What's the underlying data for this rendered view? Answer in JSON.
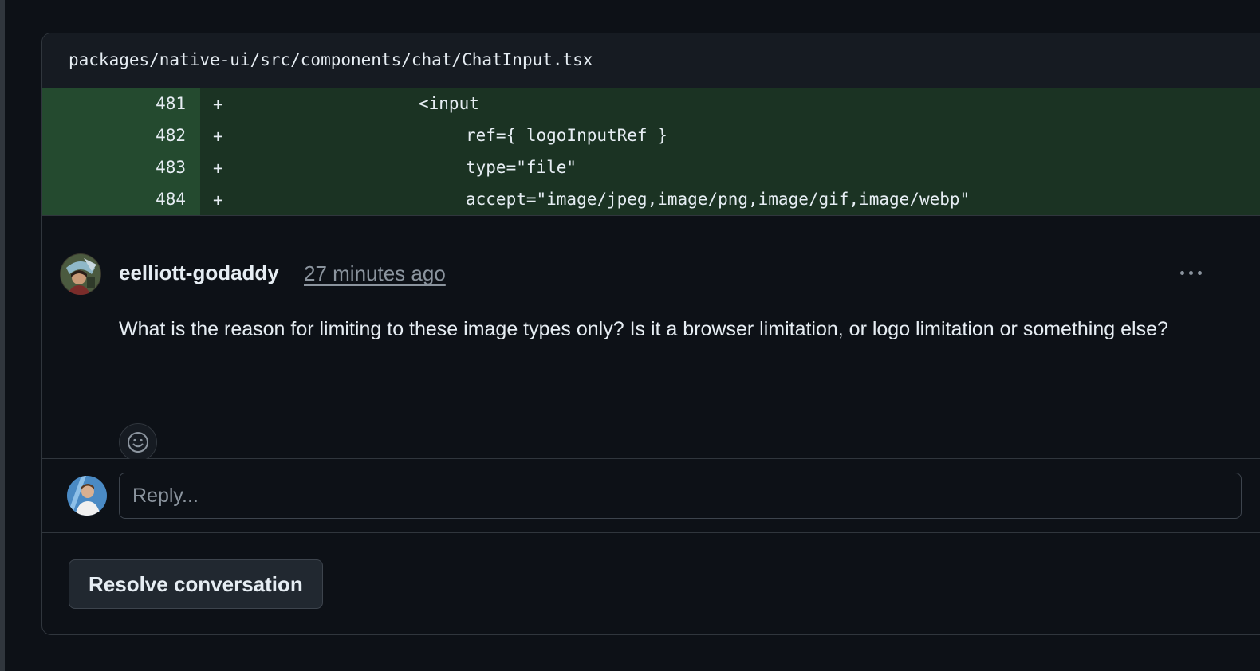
{
  "file": {
    "path": "packages/native-ui/src/components/chat/ChatInput.tsx"
  },
  "diff": {
    "lines": [
      {
        "number": "481",
        "marker": "+",
        "code": "<input"
      },
      {
        "number": "482",
        "marker": "+",
        "code": "ref={ logoInputRef }"
      },
      {
        "number": "483",
        "marker": "+",
        "code": "type=\"file\""
      },
      {
        "number": "484",
        "marker": "+",
        "code": "accept=\"image/jpeg,image/png,image/gif,image/webp\""
      }
    ]
  },
  "comment": {
    "author": "eelliott-godaddy",
    "timestamp": "27 minutes ago",
    "body": "What is the reason for limiting to these image types only? Is it a browser limitation, or logo limitation or something else?",
    "more_icon": "kebab-horizontal-icon",
    "reaction_icon": "smiley-icon"
  },
  "reply": {
    "placeholder": "Reply..."
  },
  "actions": {
    "resolve_label": "Resolve conversation"
  },
  "colors": {
    "background": "#0d1117",
    "diff_added_bg": "#1b3323",
    "diff_added_gutter": "#244a2f",
    "border": "#30363d",
    "muted_text": "#8b949e"
  }
}
